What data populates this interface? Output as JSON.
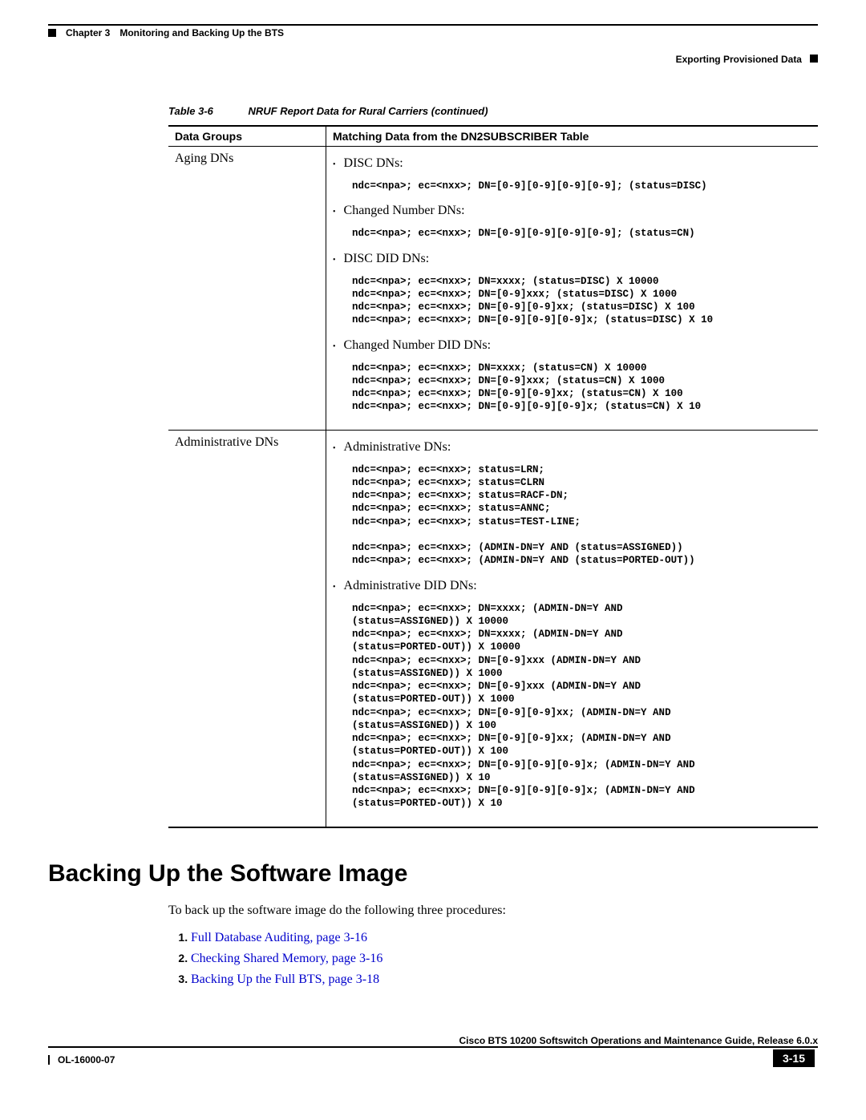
{
  "header": {
    "chapter": "Chapter 3",
    "title": "Monitoring and Backing Up the BTS",
    "section": "Exporting Provisioned Data"
  },
  "table": {
    "caption_label": "Table 3-6",
    "caption_text": "NRUF Report Data for Rural Carriers (continued)",
    "col1": "Data Groups",
    "col2": "Matching Data from the DN2SUBSCRIBER Table",
    "row1_group": "Aging DNs",
    "row1": {
      "b1": "DISC DNs:",
      "c1": "ndc=<npa>; ec=<nxx>; DN=[0-9][0-9][0-9][0-9]; (status=DISC)",
      "b2": "Changed Number DNs:",
      "c2": "ndc=<npa>; ec=<nxx>; DN=[0-9][0-9][0-9][0-9]; (status=CN)",
      "b3": "DISC DID DNs:",
      "c3": "ndc=<npa>; ec=<nxx>; DN=xxxx; (status=DISC) X 10000\nndc=<npa>; ec=<nxx>; DN=[0-9]xxx; (status=DISC) X 1000\nndc=<npa>; ec=<nxx>; DN=[0-9][0-9]xx; (status=DISC) X 100\nndc=<npa>; ec=<nxx>; DN=[0-9][0-9][0-9]x; (status=DISC) X 10",
      "b4": "Changed Number DID DNs:",
      "c4": "ndc=<npa>; ec=<nxx>; DN=xxxx; (status=CN) X 10000\nndc=<npa>; ec=<nxx>; DN=[0-9]xxx; (status=CN) X 1000\nndc=<npa>; ec=<nxx>; DN=[0-9][0-9]xx; (status=CN) X 100\nndc=<npa>; ec=<nxx>; DN=[0-9][0-9][0-9]x; (status=CN) X 10"
    },
    "row2_group": "Administrative DNs",
    "row2": {
      "b1": "Administrative DNs:",
      "c1": "ndc=<npa>; ec=<nxx>; status=LRN;\nndc=<npa>; ec=<nxx>; status=CLRN\nndc=<npa>; ec=<nxx>; status=RACF-DN;\nndc=<npa>; ec=<nxx>; status=ANNC;\nndc=<npa>; ec=<nxx>; status=TEST-LINE;\n\nndc=<npa>; ec=<nxx>; (ADMIN-DN=Y AND (status=ASSIGNED))\nndc=<npa>; ec=<nxx>; (ADMIN-DN=Y AND (status=PORTED-OUT))",
      "b2": "Administrative DID DNs:",
      "c2": "ndc=<npa>; ec=<nxx>; DN=xxxx; (ADMIN-DN=Y AND\n(status=ASSIGNED)) X 10000\nndc=<npa>; ec=<nxx>; DN=xxxx; (ADMIN-DN=Y AND\n(status=PORTED-OUT)) X 10000\nndc=<npa>; ec=<nxx>; DN=[0-9]xxx (ADMIN-DN=Y AND\n(status=ASSIGNED)) X 1000\nndc=<npa>; ec=<nxx>; DN=[0-9]xxx (ADMIN-DN=Y AND\n(status=PORTED-OUT)) X 1000\nndc=<npa>; ec=<nxx>; DN=[0-9][0-9]xx; (ADMIN-DN=Y AND\n(status=ASSIGNED)) X 100\nndc=<npa>; ec=<nxx>; DN=[0-9][0-9]xx; (ADMIN-DN=Y AND\n(status=PORTED-OUT)) X 100\nndc=<npa>; ec=<nxx>; DN=[0-9][0-9][0-9]x; (ADMIN-DN=Y AND\n(status=ASSIGNED)) X 10\nndc=<npa>; ec=<nxx>; DN=[0-9][0-9][0-9]x; (ADMIN-DN=Y AND\n(status=PORTED-OUT)) X 10"
    }
  },
  "heading": "Backing Up the Software Image",
  "intro": "To back up the software image do the following three procedures:",
  "steps": {
    "s1": "Full Database Auditing, page 3-16",
    "s2": "Checking Shared Memory, page 3-16",
    "s3": "Backing Up the Full BTS, page 3-18"
  },
  "footer": {
    "guide": "Cisco BTS 10200 Softswitch Operations and Maintenance Guide, Release 6.0.x",
    "doc": "OL-16000-07",
    "page": "3-15"
  }
}
